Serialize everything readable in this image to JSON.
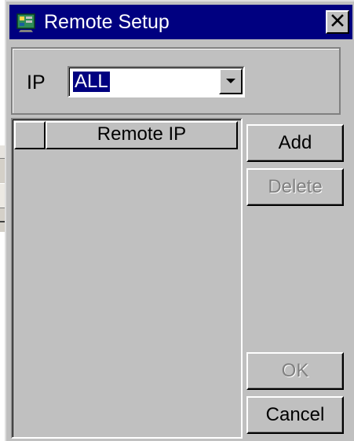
{
  "window": {
    "title": "Remote Setup",
    "icon": "remote-setup-app-icon",
    "close_icon": "close-x-icon"
  },
  "ip_filter": {
    "label": "IP",
    "value": "ALL",
    "dropdown_icon": "chevron-down-icon"
  },
  "list": {
    "columns": [
      "",
      "Remote IP"
    ],
    "rows": []
  },
  "buttons": {
    "add": "Add",
    "delete": "Delete",
    "ok": "OK",
    "cancel": "Cancel"
  },
  "colors": {
    "title_bar": "#000080",
    "face": "#c0c0c0",
    "selection": "#000080",
    "disabled_text": "#808080"
  }
}
